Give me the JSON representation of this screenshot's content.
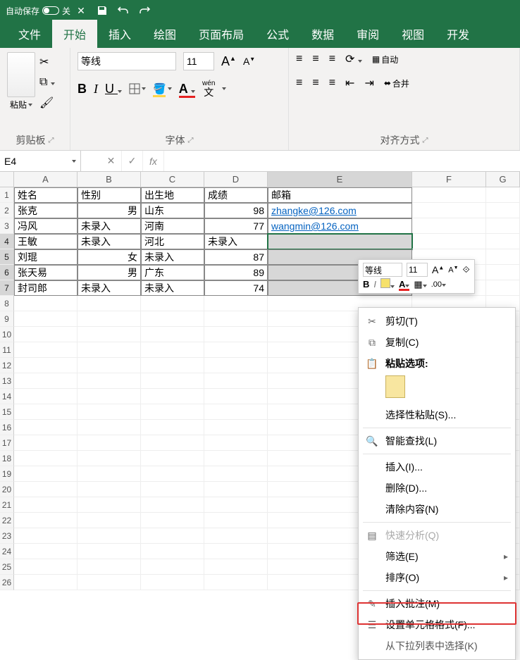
{
  "titlebar": {
    "autosave": "自动保存",
    "autosave_state": "关"
  },
  "tabs": [
    "文件",
    "开始",
    "插入",
    "绘图",
    "页面布局",
    "公式",
    "数据",
    "审阅",
    "视图",
    "开发"
  ],
  "active_tab": 1,
  "ribbon": {
    "clipboard": {
      "paste": "粘贴",
      "title": "剪贴板"
    },
    "font": {
      "name": "等线",
      "size": "11",
      "title": "字体",
      "wen_label": "wén",
      "wen_sub": "文"
    },
    "alignment": {
      "title": "对齐方式",
      "auto_label": "自动",
      "merge_label": "合并"
    }
  },
  "formula_bar": {
    "cell_ref": "E4",
    "fx": "fx",
    "value": ""
  },
  "columns": [
    "A",
    "B",
    "C",
    "D",
    "E",
    "F",
    "G"
  ],
  "rows": 26,
  "selected_col": "E",
  "selected_rows_start": 4,
  "selected_rows_end": 7,
  "table": {
    "headers": [
      "姓名",
      "性别",
      "出生地",
      "成绩",
      "邮箱"
    ],
    "data": [
      {
        "name": "张克",
        "gender": "男",
        "place": "山东",
        "score": "98",
        "email": "zhangke@126.com"
      },
      {
        "name": "冯风",
        "gender": "未录入",
        "place": "河南",
        "score": "77",
        "email": "wangmin@126.com"
      },
      {
        "name": "王敏",
        "gender": "未录入",
        "place": "河北",
        "score": "未录入",
        "email": ""
      },
      {
        "name": "刘琨",
        "gender": "女",
        "place": "未录入",
        "score": "87",
        "email": ""
      },
      {
        "name": "张天易",
        "gender": "男",
        "place": "广东",
        "score": "89",
        "email": ""
      },
      {
        "name": "封司郎",
        "gender": "未录入",
        "place": "未录入",
        "score": "74",
        "email": ""
      }
    ]
  },
  "mini_toolbar": {
    "font": "等线",
    "size": "11"
  },
  "context_menu": {
    "cut": "剪切(T)",
    "copy": "复制(C)",
    "paste_options": "粘贴选项:",
    "paste_special": "选择性粘贴(S)...",
    "smart_lookup": "智能查找(L)",
    "insert": "插入(I)...",
    "delete": "删除(D)...",
    "clear": "清除内容(N)",
    "quick_analysis": "快速分析(Q)",
    "filter": "筛选(E)",
    "sort": "排序(O)",
    "insert_comment": "插入批注(M)",
    "format_cells": "设置单元格格式(F)...",
    "pick_from_list": "从下拉列表中选择(K)"
  }
}
